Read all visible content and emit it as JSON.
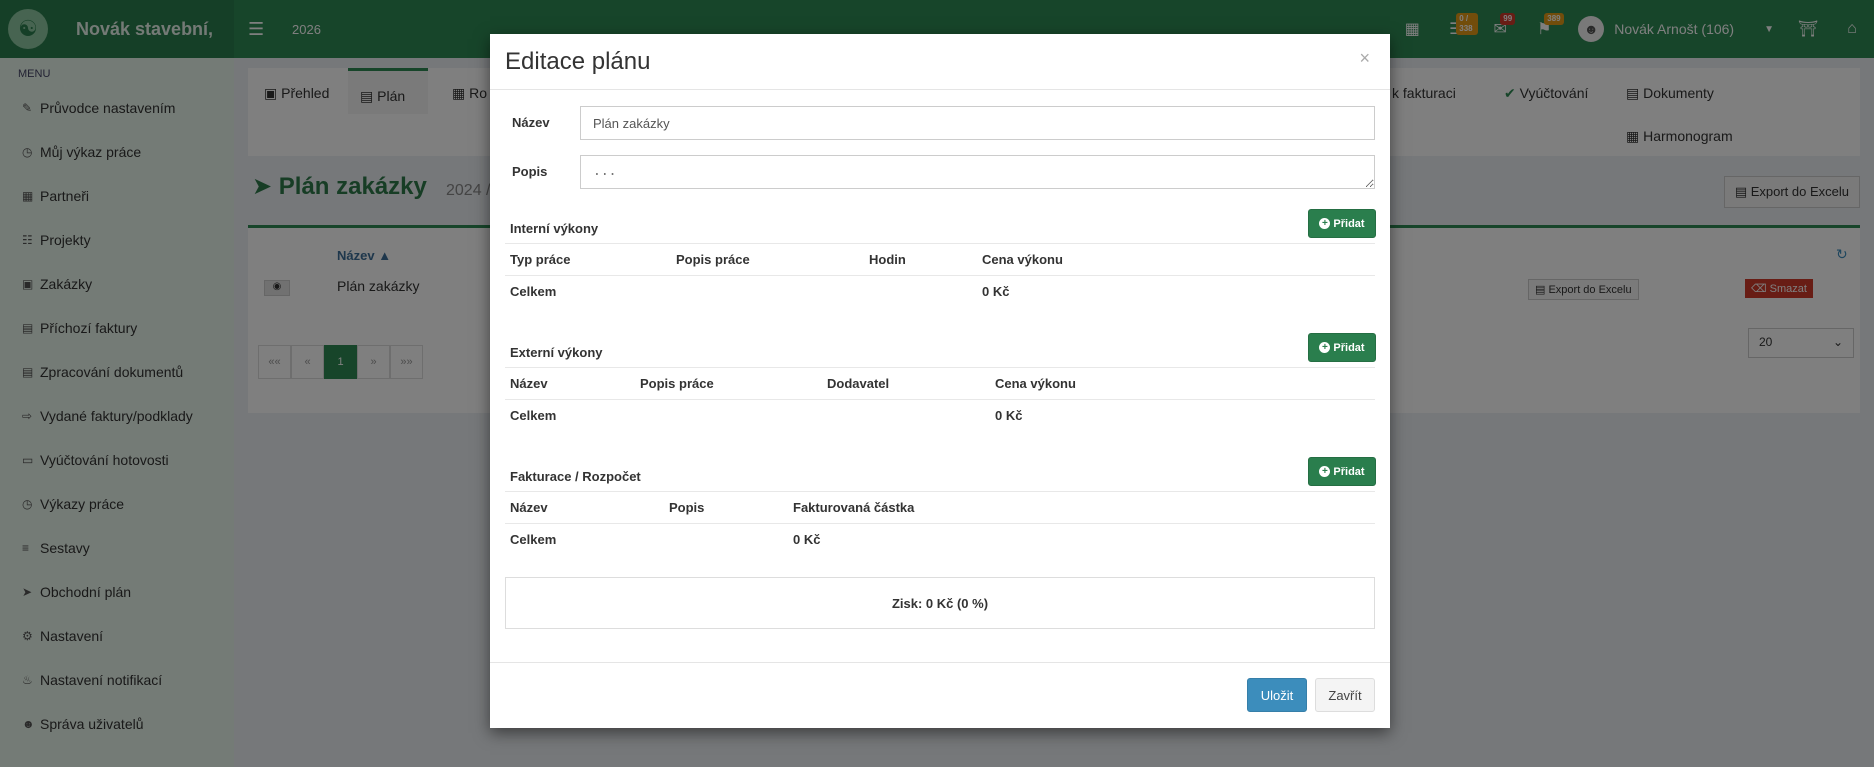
{
  "navbar": {
    "brand": "Novák stavební,",
    "year": "2026",
    "badges": {
      "tasks": "0 / 338",
      "messages": "99",
      "notifications": "389"
    },
    "user_name": "Novák Arnošt (106)"
  },
  "sidebar": {
    "header": "MENU",
    "items": [
      {
        "label": "Průvodce nastavením",
        "icon": "pencil-icon"
      },
      {
        "label": "Můj výkaz práce",
        "icon": "clock-icon"
      },
      {
        "label": "Partneři",
        "icon": "building-icon"
      },
      {
        "label": "Projekty",
        "icon": "sitemap-icon"
      },
      {
        "label": "Zakázky",
        "icon": "cube-icon"
      },
      {
        "label": "Příchozí faktury",
        "icon": "file-icon"
      },
      {
        "label": "Zpracování dokumentů",
        "icon": "file-icon"
      },
      {
        "label": "Vydané faktury/podklady",
        "icon": "file-export-icon"
      },
      {
        "label": "Vyúčtování hotovosti",
        "icon": "money-icon"
      },
      {
        "label": "Výkazy práce",
        "icon": "clock-icon"
      },
      {
        "label": "Sestavy",
        "icon": "list-icon"
      },
      {
        "label": "Obchodní plán",
        "icon": "paper-plane-icon"
      },
      {
        "label": "Nastavení",
        "icon": "gears-icon"
      },
      {
        "label": "Nastavení notifikací",
        "icon": "bell-icon"
      },
      {
        "label": "Správa uživatelů",
        "icon": "users-icon"
      }
    ]
  },
  "tabs": {
    "overview": "Přehled",
    "plan": "Plán",
    "partial": "Ro",
    "billing": "ly k fakturaci",
    "settlement": "Vyúčtování",
    "documents": "Dokumenty",
    "schedule": "Harmonogram"
  },
  "page": {
    "title": "Plán zakázky",
    "subtitle": "2024 /",
    "export": "Export do Excelu",
    "table_header_name": "Název",
    "row_name": "Plán zakázky",
    "row_export": "Export do Excelu",
    "row_delete": "Smazat",
    "pager": [
      "««",
      "«",
      "1",
      "»",
      "»»"
    ],
    "page_size": "20"
  },
  "modal": {
    "title": "Editace plánu",
    "close": "×",
    "name_label": "Název",
    "name_value": "Plán zakázky",
    "desc_label": "Popis",
    "desc_placeholder": "...",
    "add_label": "Přidat",
    "internal": {
      "title": "Interní výkony",
      "columns": [
        "Typ práce",
        "Popis práce",
        "Hodin",
        "Cena výkonu"
      ],
      "total_label": "Celkem",
      "total_value": "0 Kč"
    },
    "external": {
      "title": "Externí výkony",
      "columns": [
        "Název",
        "Popis práce",
        "Dodavatel",
        "Cena výkonu"
      ],
      "total_label": "Celkem",
      "total_value": "0 Kč"
    },
    "invoicing": {
      "title": "Fakturace / Rozpočet",
      "columns": [
        "Název",
        "Popis",
        "Fakturovaná částka"
      ],
      "total_label": "Celkem",
      "total_value": "0 Kč"
    },
    "profit": "Zisk: 0 Kč (0 %)",
    "save": "Uložit",
    "dismiss": "Zavřít"
  }
}
